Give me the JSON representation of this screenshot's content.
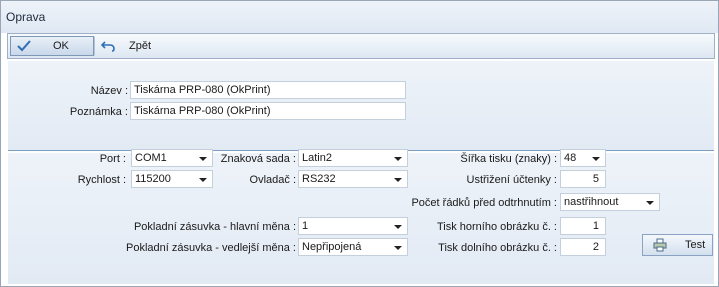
{
  "window": {
    "title": "Oprava"
  },
  "toolbar": {
    "ok_label": "OK",
    "back_label": "Zpět"
  },
  "form": {
    "name_label": "Název :",
    "name_value": "Tiskárna PRP-080 (OkPrint)",
    "note_label": "Poznámka :",
    "note_value": "Tiskárna PRP-080 (OkPrint)",
    "port_label": "Port :",
    "port_value": "COM1",
    "speed_label": "Rychlost :",
    "speed_value": "115200",
    "charset_label": "Znaková sada :",
    "charset_value": "Latin2",
    "driver_label": "Ovladač :",
    "driver_value": "RS232",
    "print_width_label": "Šířka tisku (znaky) :",
    "print_width_value": "48",
    "cut_label": "Ustřižení účtenky :",
    "cut_value": "5",
    "lines_before_cut_label": "Počet řádků před odtrhnutím :",
    "lines_before_cut_value": "nastřihnout",
    "drawer_main_label": "Pokladní zásuvka - hlavní měna :",
    "drawer_main_value": "1",
    "drawer_secondary_label": "Pokladní zásuvka - vedlejší měna :",
    "drawer_secondary_value": "Nepřipojená",
    "top_image_label": "Tisk horního obrázku č. :",
    "top_image_value": "1",
    "bottom_image_label": "Tisk dolního obrázku č. :",
    "bottom_image_value": "2",
    "test_label": "Test"
  },
  "colors": {
    "accent": "#7f9ec4",
    "panel": "#e8eef6"
  },
  "icons": {
    "ok": "check-icon",
    "back": "undo-icon",
    "test": "printer-icon"
  }
}
